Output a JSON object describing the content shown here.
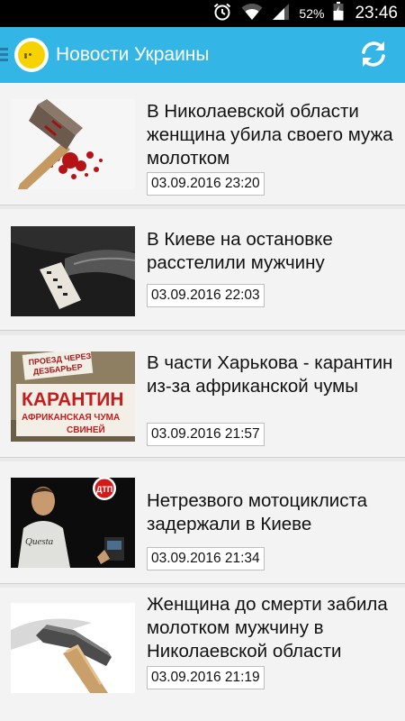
{
  "status_bar": {
    "battery_percent": "52%",
    "time": "23:46",
    "icons": [
      "alarm-icon",
      "wifi-icon",
      "signal-icon",
      "battery-icon"
    ]
  },
  "app_bar": {
    "title": "Новости Украины",
    "icons": [
      "app-logo-icon",
      "refresh-icon"
    ]
  },
  "news": [
    {
      "title": "В Николаевской области женщина убила своего мужа молотком",
      "date": "03.09.2016 23:20",
      "image": "bloody-hammer"
    },
    {
      "title": "В Киеве на остановке расстелили мужчину",
      "date": "03.09.2016 22:03",
      "image": "car-evidence-marker"
    },
    {
      "title": "В части Харькова - карантин из-за африканской чумы",
      "date": "03.09.2016 21:57",
      "image": "quarantine-sign"
    },
    {
      "title": "Нетрезвого мотоциклиста задержали в Киеве",
      "date": "03.09.2016 21:34",
      "image": "man-at-night"
    },
    {
      "title": "Женщина до смерти забила молотком мужчину в Николаевской области",
      "date": "03.09.2016 21:19",
      "image": "hammer"
    }
  ],
  "image_text": {
    "sign_line1": "ПРОЕЗД ЧЕРЕЗ",
    "sign_line2": "ДЕЗБАРЬЕР",
    "sign_main": "КАРАНТИН",
    "sign_sub1": "АФРИКАНСКАЯ ЧУМА",
    "sign_sub2": "СВИНЕЙ",
    "dtp_badge": "ДТП",
    "shirt_text": "Questa"
  },
  "colors": {
    "app_bar": "#33b5e5",
    "status_bar": "#000000",
    "card_background": "#f3f3f3",
    "page_background": "#e9e9e9"
  }
}
